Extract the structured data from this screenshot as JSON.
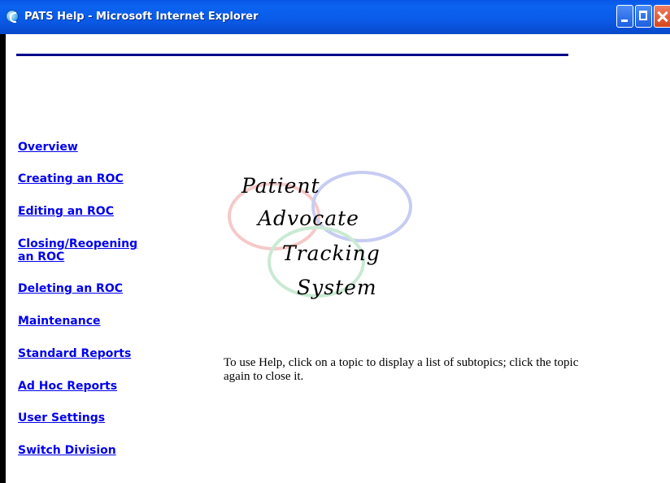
{
  "window": {
    "title": "PATS Help - Microsoft Internet Explorer"
  },
  "nav": {
    "items": [
      {
        "label": "Overview"
      },
      {
        "label": "Creating an ROC"
      },
      {
        "label": "Editing an ROC"
      },
      {
        "label": "Closing/Reopening an ROC"
      },
      {
        "label": "Deleting an ROC"
      },
      {
        "label": "Maintenance"
      },
      {
        "label": "Standard Reports"
      },
      {
        "label": "Ad Hoc Reports"
      },
      {
        "label": "User Settings"
      },
      {
        "label": "Switch Division"
      }
    ]
  },
  "logo": {
    "line1": "Patient",
    "line2": "Advocate",
    "line3": "Tracking",
    "line4": "System",
    "ring_colors": [
      "#f5c9c9",
      "#c7ccf2",
      "#c9ead3"
    ]
  },
  "help": {
    "text": "To use Help, click on a topic to display a list of subtopics; click the topic again to close it."
  }
}
